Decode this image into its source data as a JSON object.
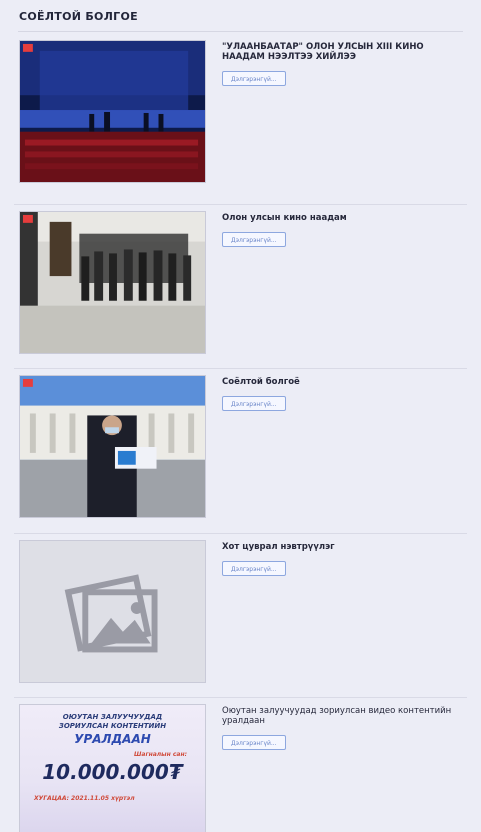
{
  "section": {
    "title": "СОЁЛТОЙ БОЛГОЕ"
  },
  "items": [
    {
      "title": "\"УЛААНБААТАР\" ОЛОН УЛСЫН XIII КИНО НААДАМ НЭЭЛТЭЭ ХИЙЛЭЭ",
      "button_label": "Дэлгэрэнгүй...",
      "thumbnail": "photo",
      "thumbnail_description": "cinema stage with blue lighting"
    },
    {
      "title": "Олон улсын кино наадам",
      "button_label": "Дэлгэрэнгүй...",
      "thumbnail": "photo",
      "thumbnail_description": "group of people standing in a hall"
    },
    {
      "title": "Соёлтой болгоё",
      "button_label": "Дэлгэрэнгүй...",
      "thumbnail": "photo",
      "thumbnail_description": "man holding certificate in front of government palace"
    },
    {
      "title": "Хот цуврал нэвтрүүлэг",
      "button_label": "Дэлгэрэнгүй...",
      "thumbnail": "placeholder-image-icon"
    },
    {
      "title": "Оюутан залуучуудад зориулсан видео контентийн уралдаан",
      "button_label": "Дэлгэрэнгүй...",
      "thumbnail": "poster",
      "poster": {
        "line1": "ОЮУТАН ЗАЛУУЧУУДАД",
        "line2": "ЗОРИУЛСАН КОНТЕНТИЙН",
        "line3": "УРАЛДААН",
        "prize_label": "Шагналын сан:",
        "prize": "10.000.000₮",
        "deadline": "ХУГАЦАА: 2021.11.05 хүртэл"
      }
    }
  ]
}
